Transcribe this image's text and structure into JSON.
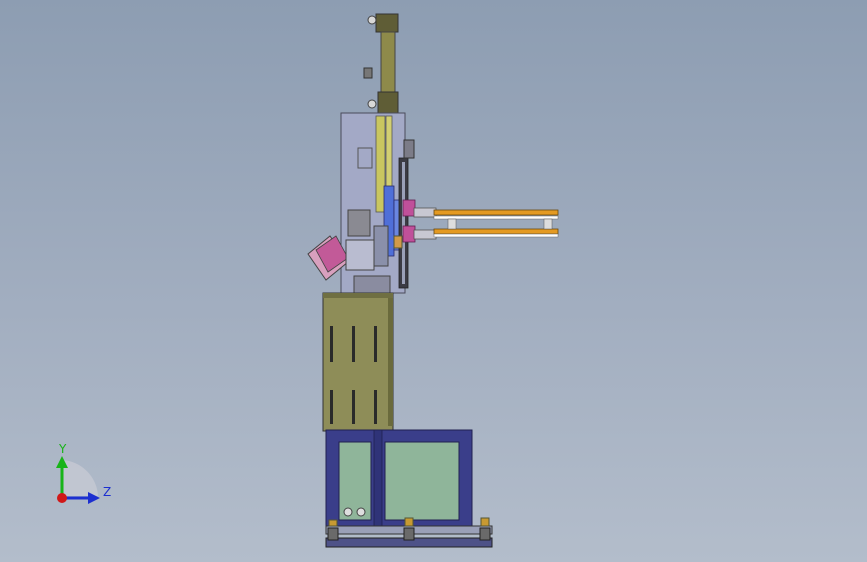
{
  "triad": {
    "y_label": "Y",
    "z_label": "Z",
    "colors": {
      "y": "#18b418",
      "z": "#1c2fd0",
      "origin": "#d01818"
    }
  },
  "colors": {
    "background": "#9aa8bb",
    "cylinder": "#8e8a4a",
    "cabinet": "#8e8d58",
    "frame": "#3a3e8a",
    "panel_glass": "#8fb59a",
    "gripper_bar": "#e49a22",
    "side_plate": "#a3a9c6",
    "yellow_strip": "#c9c660",
    "blue_strip": "#4f6fd8",
    "magenta_block": "#c0509a"
  }
}
